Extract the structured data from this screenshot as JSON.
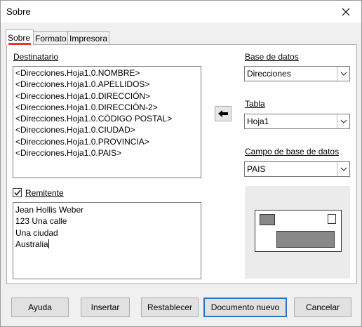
{
  "window": {
    "title": "Sobre"
  },
  "tabs": [
    {
      "label": "Sobre",
      "active": true
    },
    {
      "label": "Formato",
      "active": false
    },
    {
      "label": "Impresora",
      "active": false
    }
  ],
  "addressee": {
    "label": "Destinatario",
    "lines": [
      "<Direcciones.Hoja1.0.NOMBRE>",
      "<Direcciones.Hoja1.0.APELLIDOS>",
      "<Direcciones.Hoja1.0.DIRECCIÓN>",
      "<Direcciones.Hoja1.0.DIRECCIÓN-2>",
      "<Direcciones.Hoja1.0.CÓDIGO POSTAL>",
      "<Direcciones.Hoja1.0.CIUDAD>",
      "<Direcciones.Hoja1.0.PROVINCIA>",
      "<Direcciones.Hoja1.0.PAIS>"
    ]
  },
  "sender": {
    "label": "Remitente",
    "checked": true,
    "lines": [
      "Jean Hollis Weber",
      "123 Una calle",
      "Una ciudad",
      "Australia"
    ]
  },
  "database": {
    "label": "Base de datos",
    "value": "Direcciones"
  },
  "table": {
    "label": "Tabla",
    "value": "Hoja1"
  },
  "field": {
    "label": "Campo de base de datos",
    "value": "PAIS"
  },
  "insert_arrow": "left-arrow-icon",
  "buttons": {
    "help": "Ayuda",
    "insert": "Insertar",
    "reset": "Restablecer",
    "new_document": "Documento nuevo",
    "cancel": "Cancelar"
  },
  "colors": {
    "accent": "#2a72c9",
    "tab_underline": "#e03a2b"
  }
}
